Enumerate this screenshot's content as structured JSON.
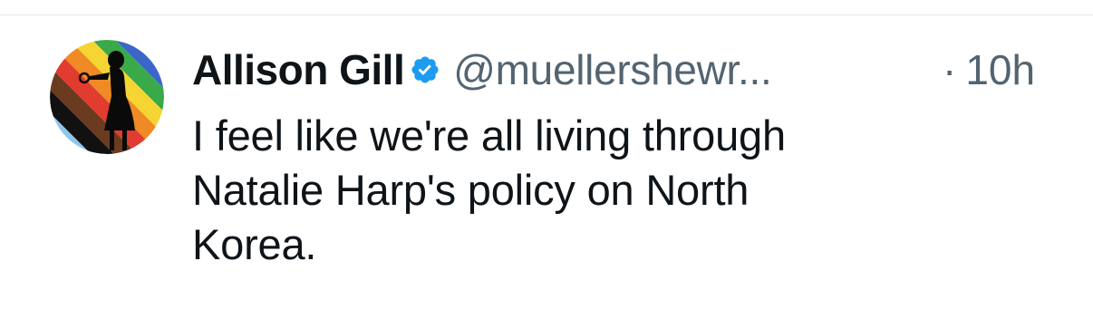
{
  "post": {
    "author": {
      "display_name": "Allison Gill",
      "handle": "@muellershewr...",
      "verified": true,
      "avatar_icon": "silhouette-on-rainbow-icon"
    },
    "separator": "·",
    "timestamp": "10h",
    "text_lines": [
      "I feel like we're all living through",
      "Natalie Harp's policy on North",
      "Korea."
    ]
  },
  "colors": {
    "text": "#0f1419",
    "secondary": "#536471",
    "verified_badge": "#1d9bf0",
    "divider": "#e6e8ea"
  }
}
